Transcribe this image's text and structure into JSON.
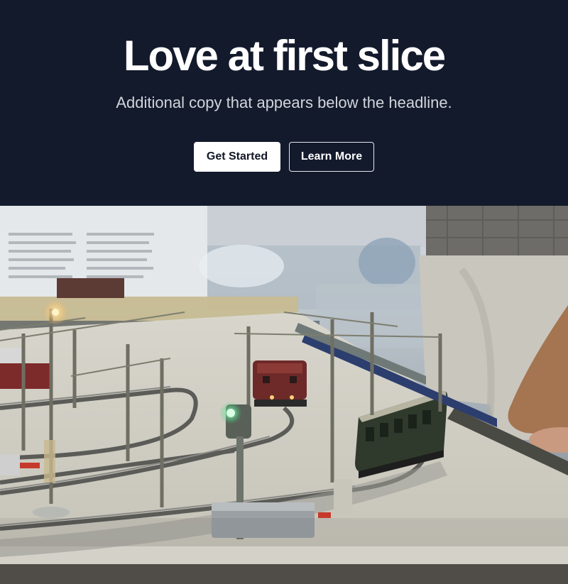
{
  "hero": {
    "headline": "Love at first slice",
    "subcopy": "Additional copy that appears below the headline.",
    "primary_label": "Get Started",
    "secondary_label": "Learn More"
  },
  "image": {
    "alt": "Model railway layout with trains, overhead catenary poles and signals"
  },
  "colors": {
    "hero_background": "#131a2c",
    "headline": "#ffffff",
    "subcopy": "#d1d5db",
    "primary_button_bg": "#ffffff",
    "primary_button_text": "#111827"
  }
}
